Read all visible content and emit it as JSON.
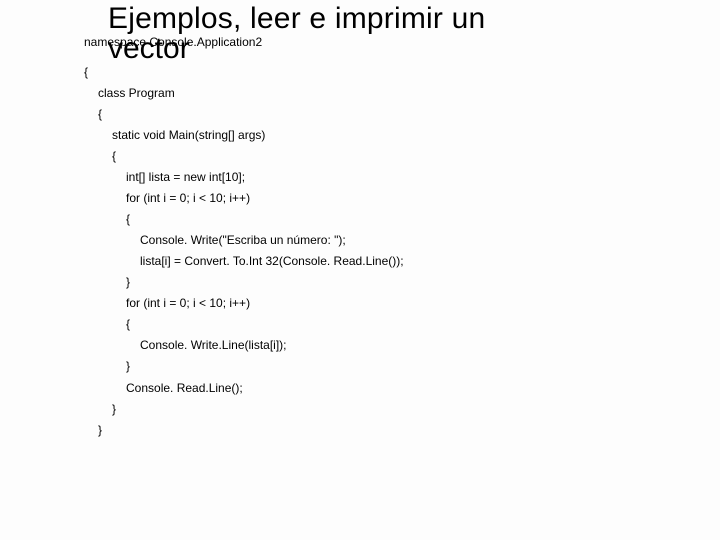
{
  "title_line1": "Ejemplos, leer e imprimir un",
  "title_line2": "vector",
  "lines": {
    "l1": "namespace Console.Application2",
    "l2": "{",
    "l3": "class Program",
    "l4": "{",
    "l5": "static void Main(string[] args)",
    "l6": "{",
    "l7": "int[] lista = new int[10];",
    "l8": "for (int i = 0; i < 10; i++)",
    "l9": "{",
    "l10": "Console. Write(\"Escriba un número: \");",
    "l11": "lista[i] = Convert. To.Int 32(Console. Read.Line());",
    "l12": "}",
    "l13": "for (int i = 0; i < 10; i++)",
    "l14": "{",
    "l15": "Console. Write.Line(lista[i]);",
    "l16": "}",
    "l17": "Console. Read.Line();",
    "l18": "}",
    "l19": "}"
  }
}
